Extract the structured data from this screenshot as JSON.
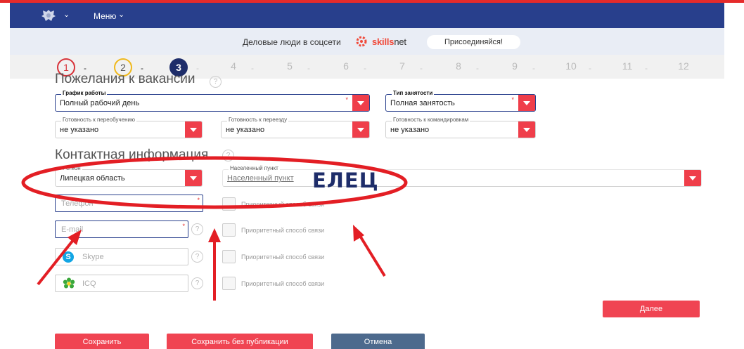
{
  "nav": {
    "menu_label": "Меню"
  },
  "promo": {
    "text": "Деловые люди в соцсети",
    "brand_prefix": "skills",
    "brand_suffix": "net",
    "join_label": "Присоединяйся!"
  },
  "steps": [
    "1",
    "2",
    "3",
    "4",
    "5",
    "6",
    "7",
    "8",
    "9",
    "10",
    "11",
    "12"
  ],
  "steps_current": 3,
  "vacancy": {
    "title": "Пожелания к вакансии",
    "schedule": {
      "label": "График работы",
      "value": "Полный рабочий день"
    },
    "employment": {
      "label": "Тип занятости",
      "value": "Полная занятость"
    },
    "retraining": {
      "label": "Готовность к переобучению",
      "value": "не указано"
    },
    "relocation": {
      "label": "Готовность к переезду",
      "value": "не указано"
    },
    "business_trips": {
      "label": "Готовность к командировкам",
      "value": "не указано"
    }
  },
  "contacts": {
    "title": "Контактная информация",
    "region": {
      "label": "Регион",
      "value": "Липецкая область"
    },
    "locality": {
      "label": "Населенный пункт",
      "placeholder": "Населенный пункт"
    },
    "phone_placeholder": "Телефон",
    "email_placeholder": "E-mail",
    "skype_placeholder": "Skype",
    "icq_placeholder": "ICQ",
    "priority_label": "Приоритетный способ связи"
  },
  "annotation_word": "ЕЛЕЦ",
  "buttons": {
    "next": "Далее",
    "save": "Сохранить",
    "save_unpublished": "Сохранить без публикации",
    "cancel": "Отмена"
  },
  "colors": {
    "nav": "#283f8c",
    "accent": "#ef3e4a",
    "annotation": "#e31e24",
    "cancel": "#4d6a8d"
  }
}
